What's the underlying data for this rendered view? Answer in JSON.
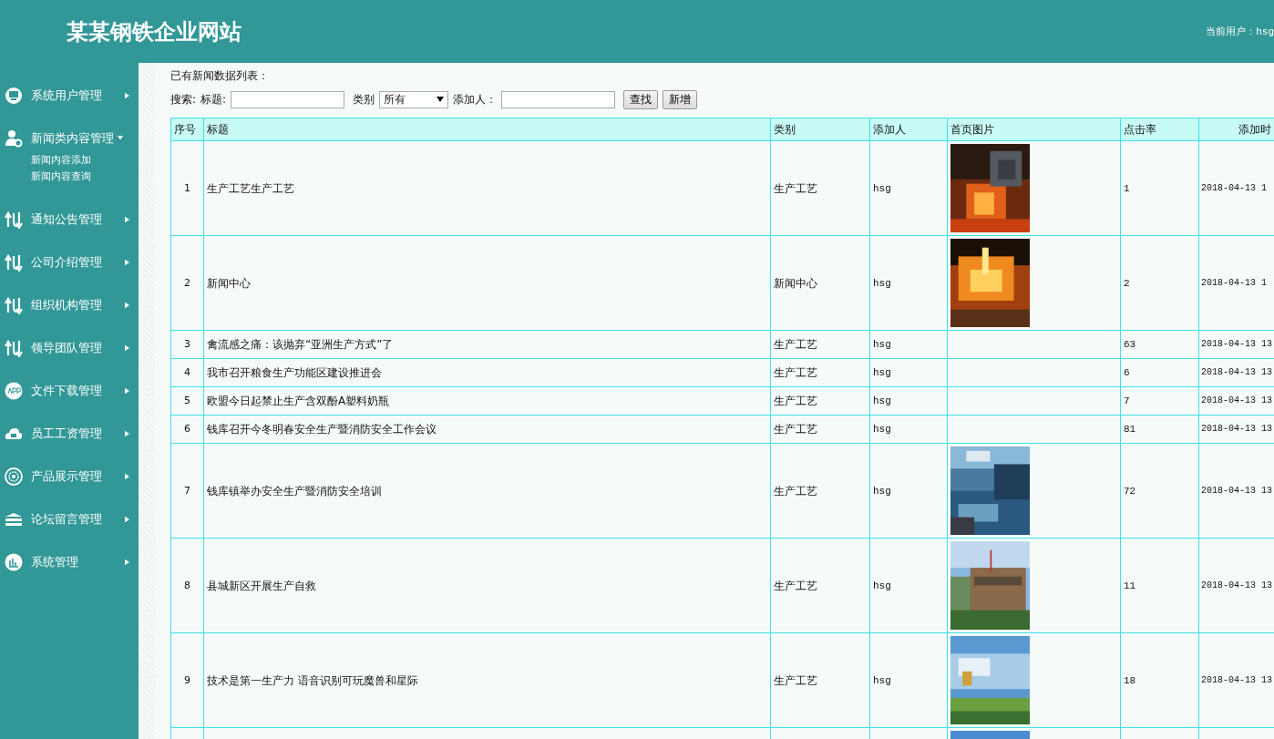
{
  "header": {
    "title": "某某钢铁企业网站",
    "user_label": "当前用户：",
    "user": "hsg"
  },
  "sidebar": {
    "items": [
      {
        "label": "系统用户管理",
        "expanded": false
      },
      {
        "label": "新闻类内容管理",
        "expanded": true,
        "children": [
          {
            "label": "新闻内容添加"
          },
          {
            "label": "新闻内容查询"
          }
        ]
      },
      {
        "label": "通知公告管理",
        "expanded": false
      },
      {
        "label": "公司介绍管理",
        "expanded": false
      },
      {
        "label": "组织机构管理",
        "expanded": false
      },
      {
        "label": "领导团队管理",
        "expanded": false
      },
      {
        "label": "文件下载管理",
        "expanded": false
      },
      {
        "label": "员工工资管理",
        "expanded": false
      },
      {
        "label": "产品展示管理",
        "expanded": false
      },
      {
        "label": "论坛留言管理",
        "expanded": false
      },
      {
        "label": "系统管理",
        "expanded": false
      }
    ]
  },
  "content": {
    "heading": "已有新闻数据列表：",
    "search": {
      "label": "搜索:",
      "title_label": "标题:",
      "category_label": "类别",
      "category_value": "所有",
      "adder_label": "添加人：",
      "buttons": [
        "查找",
        "新增"
      ]
    },
    "table": {
      "columns": [
        "序号",
        "标题",
        "类别",
        "添加人",
        "首页图片",
        "点击率",
        "添加时"
      ],
      "rows": [
        {
          "no": "1",
          "title": "生产工艺生产工艺",
          "category": "生产工艺",
          "adder": "hsg",
          "picture": {
            "kind": "picture"
          },
          "clicks": "1",
          "time": "2018-04-13 1"
        },
        {
          "no": "2",
          "title": "新闻中心",
          "category": "新闻中心",
          "adder": "hsg",
          "picture": {
            "kind": "picture"
          },
          "clicks": "2",
          "time": "2018-04-13 1"
        },
        {
          "no": "3",
          "title": "禽流感之痛：该抛弃“亚洲生产方式”了",
          "category": "生产工艺",
          "adder": "hsg",
          "clicks": "63",
          "time": "2018-04-13 13"
        },
        {
          "no": "4",
          "title": "我市召开粮食生产功能区建设推进会",
          "category": "生产工艺",
          "adder": "hsg",
          "clicks": "6",
          "time": "2018-04-13 13"
        },
        {
          "no": "5",
          "title": "欧盟今日起禁止生产含双酚A塑料奶瓶",
          "category": "生产工艺",
          "adder": "hsg",
          "clicks": "7",
          "time": "2018-04-13 13"
        },
        {
          "no": "6",
          "title": "钱库召开今冬明春安全生产暨消防安全工作会议",
          "category": "生产工艺",
          "adder": "hsg",
          "clicks": "81",
          "time": "2018-04-13 13"
        },
        {
          "no": "7",
          "title": "钱库镇举办安全生产暨消防安全培训",
          "category": "生产工艺",
          "adder": "hsg",
          "picture": {
            "kind": "picture"
          },
          "clicks": "72",
          "time": "2018-04-13 13"
        },
        {
          "no": "8",
          "title": "县城新区开展生产自救",
          "category": "生产工艺",
          "adder": "hsg",
          "picture": {
            "kind": "picture"
          },
          "clicks": "11",
          "time": "2018-04-13 13"
        },
        {
          "no": "9",
          "title": "技术是第一生产力 语音识别可玩魔兽和星际",
          "category": "生产工艺",
          "adder": "hsg",
          "picture": {
            "kind": "picture"
          },
          "clicks": "18",
          "time": "2018-04-13 13"
        },
        {
          "picture": {
            "kind": "picture"
          }
        }
      ]
    }
  }
}
